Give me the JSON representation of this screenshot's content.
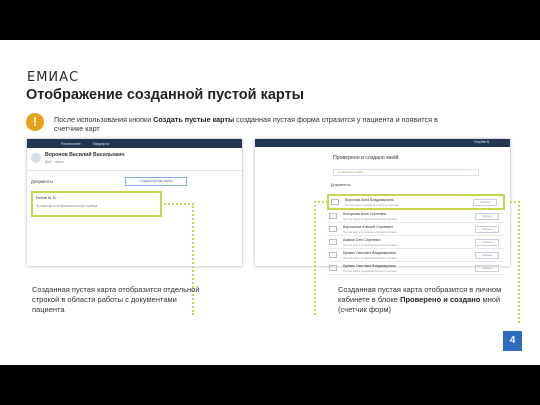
{
  "logo": "ЕМИАС",
  "title": "Отображение созданной пустой карты",
  "notice": {
    "prefix": "После использования кнопки ",
    "bold": "Создать пустые карты",
    "suffix": " созданная пустая форма отразится у пациента и появится в счетчике карт"
  },
  "left_screen": {
    "nav": [
      "Расписание",
      "Медкарта"
    ],
    "patient_name": "Воронов Василий Васильевич",
    "patient_meta": "(+7 999) 123-45-67",
    "patient_line": "ДМС · полис",
    "docs_label": "Документы",
    "add_button": "Создать пустые карты",
    "card_title": "Рябов М. В.",
    "card_sub": "Пустая карта профилактического приема"
  },
  "right_screen": {
    "user": "Голубев В.",
    "heading": "Проверено и создано мной",
    "filter": "14 Февраль 2018",
    "section": "Документы",
    "rows": [
      {
        "name": "Воронова Анна Владимировна",
        "sub": "Пустая карта профилактического приема",
        "action": "Открыть"
      },
      {
        "name": "Белоусова Анна Сергеевна",
        "sub": "Пустая карта профилактического приема",
        "action": "Открыть"
      },
      {
        "name": "Ворошилов Алексей Сергеевич",
        "sub": "Пустая карта профилактического приема",
        "action": "Открыть"
      },
      {
        "name": "Акимов Олег Сергеевич",
        "sub": "Пустая карта профилактического приема",
        "action": "Открыть"
      },
      {
        "name": "Еремин Светлана Владимировна",
        "sub": "Пустая карта профилактического приема",
        "action": "Открыть"
      },
      {
        "name": "Еремин Светлана Владимировна",
        "sub": "Пустая карта профилактического приема",
        "action": "Открыть"
      }
    ]
  },
  "caption_left": "Созданная пустая карта отобразится отдельной строкой в области работы с документами пациента",
  "caption_right": {
    "prefix": "Созданная пустая карта отобразится в личном кабинете в блоке ",
    "bold": "Проверено и создано",
    "suffix": " мной (счетчик форм)"
  },
  "page_number": "4",
  "colors": {
    "accent": "#2e6cc0",
    "highlight": "#c9d54a",
    "warning": "#e8a21a",
    "nav": "#233551"
  }
}
